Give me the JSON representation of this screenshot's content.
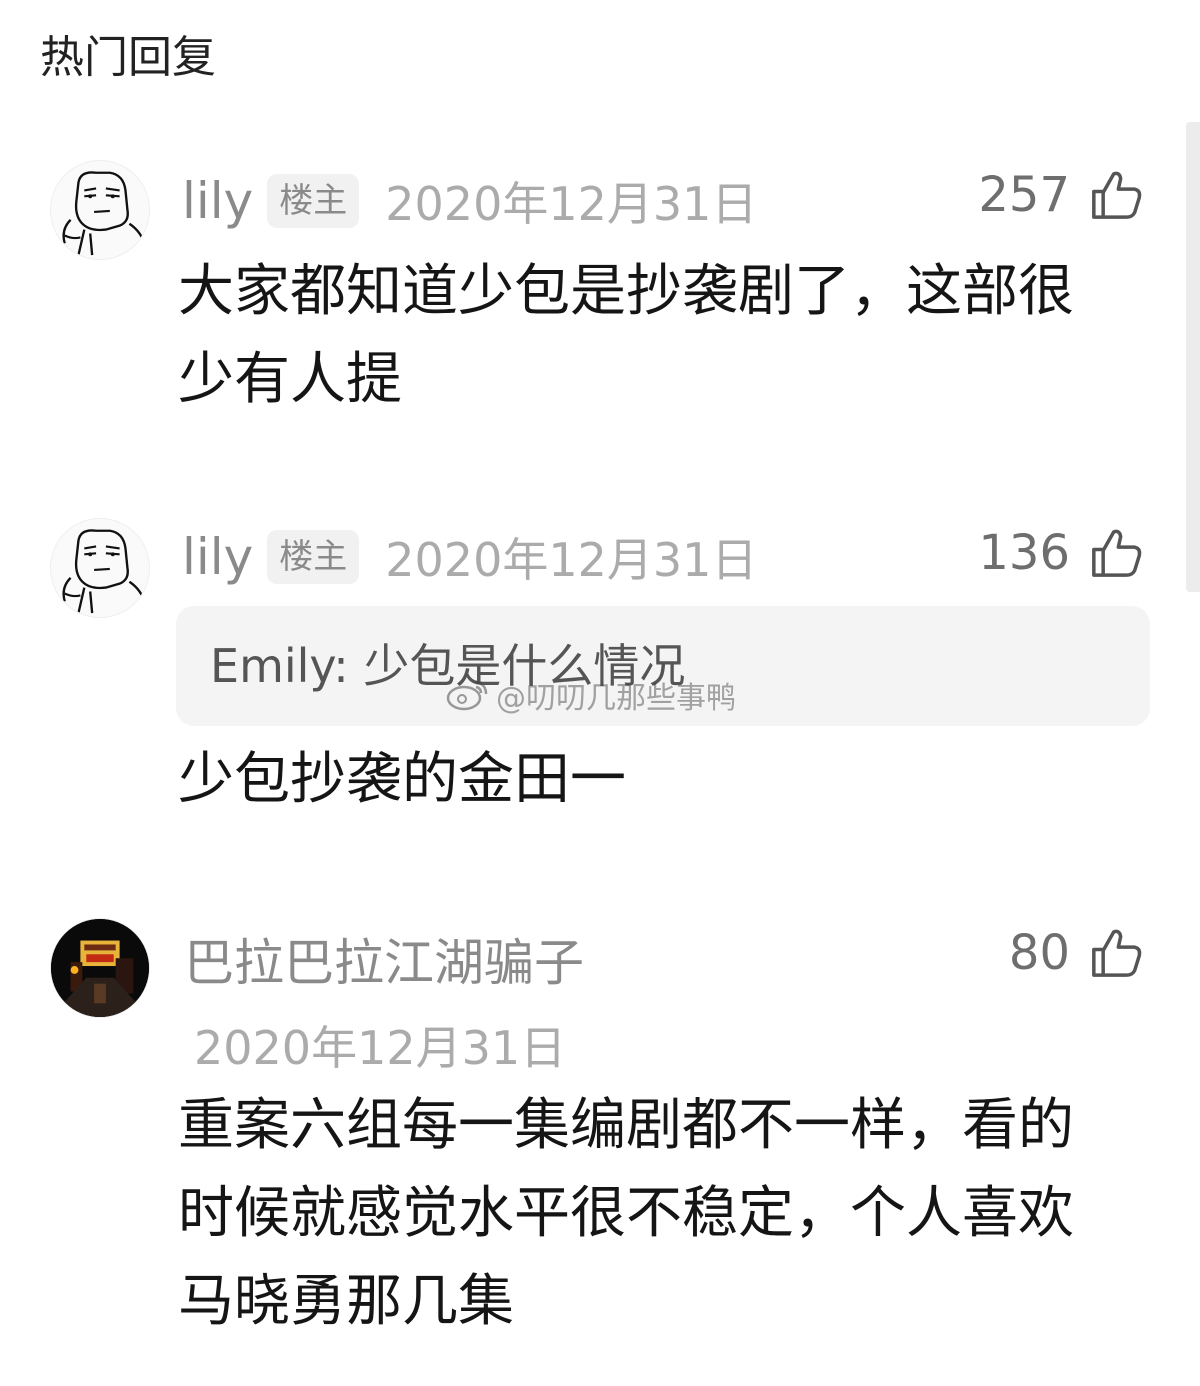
{
  "header": {
    "title": "热门回复"
  },
  "comments": [
    {
      "username": "lily",
      "badge": "楼主",
      "date": "2020年12月31日",
      "likes": "257",
      "text": "大家都知道少包是抄袭剧了，这部很少有人提",
      "avatar": "meme-face-avatar"
    },
    {
      "username": "lily",
      "badge": "楼主",
      "date": "2020年12月31日",
      "likes": "136",
      "quote": "Emily: 少包是什么情况",
      "text": "少包抄袭的金田一",
      "avatar": "meme-face-avatar"
    },
    {
      "username": "巴拉巴拉江湖骗子",
      "date": "2020年12月31日",
      "likes": "80",
      "text": "重案六组每一集编剧都不一样，看的时候就感觉水平很不稳定，个人喜欢马晓勇那几集",
      "avatar": "night-street-avatar"
    }
  ],
  "watermark": "@叨叨几那些事鸭",
  "icons": {
    "like": "thumbs-up-icon",
    "watermark_logo": "weibo-logo-icon"
  },
  "colors": {
    "username": "#8a8a8a",
    "date": "#ababab",
    "text": "#151515",
    "badge_bg": "#f1f1f1",
    "quote_bg": "#f4f4f4"
  }
}
